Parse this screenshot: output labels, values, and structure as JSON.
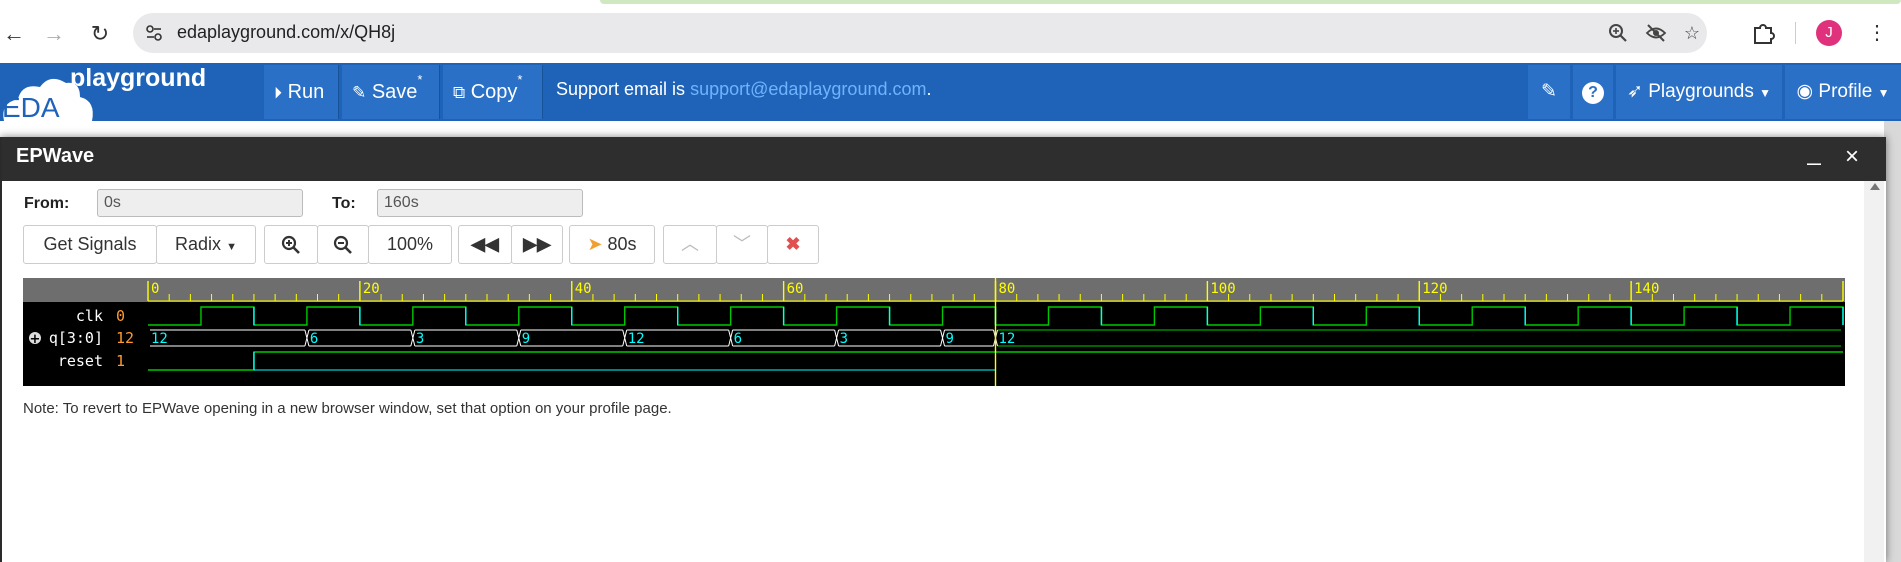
{
  "browser": {
    "url": "edaplayground.com/x/QH8j",
    "avatar_letter": "J"
  },
  "appbar": {
    "logo_eda": "EDA",
    "logo_playground": "playground",
    "run_label": "Run",
    "save_label": "Save",
    "copy_label": "Copy",
    "modified_mark": "*",
    "support_prefix": "Support email is ",
    "support_email": "support@edaplayground.com",
    "support_suffix": ".",
    "playgrounds_label": "Playgrounds",
    "profile_label": "Profile"
  },
  "modal": {
    "title": "EPWave",
    "minimize": "_",
    "close": "×"
  },
  "controls": {
    "from_label": "From:",
    "from_value": "0s",
    "to_label": "To:",
    "to_value": "160s",
    "get_signals": "Get Signals",
    "radix": "Radix",
    "zoom_level": "100%",
    "cursor_time": "80s"
  },
  "waveform": {
    "time_range": [
      0,
      160
    ],
    "cursor": 80,
    "ruler_labels": [
      "0",
      "20",
      "40",
      "60",
      "80",
      "100",
      "120",
      "140"
    ],
    "signals": [
      {
        "name": "clk",
        "value": "0",
        "type": "clock",
        "period": 10,
        "first_rise": 5
      },
      {
        "name": "q[3:0]",
        "value": "12",
        "type": "bus",
        "segments": [
          {
            "t0": 0,
            "t1": 15,
            "label": "12"
          },
          {
            "t0": 15,
            "t1": 25,
            "label": "6"
          },
          {
            "t0": 25,
            "t1": 35,
            "label": "3"
          },
          {
            "t0": 35,
            "t1": 45,
            "label": "9"
          },
          {
            "t0": 45,
            "t1": 55,
            "label": "12"
          },
          {
            "t0": 55,
            "t1": 65,
            "label": "6"
          },
          {
            "t0": 65,
            "t1": 75,
            "label": "3"
          },
          {
            "t0": 75,
            "t1": 80,
            "label": "9"
          },
          {
            "t0": 80,
            "t1": 160,
            "label": "12"
          }
        ]
      },
      {
        "name": "reset",
        "value": "1",
        "type": "bit",
        "rise": 10
      }
    ]
  },
  "note": "Note: To revert to EPWave opening in a new browser window, set that option on your profile page.",
  "colors": {
    "navbar": "#1f63b8",
    "wave_green": "#00c800",
    "wave_cyan": "#00ffff",
    "ruler_yellow": "#ffff00",
    "value_orange": "#ff9a2e"
  }
}
